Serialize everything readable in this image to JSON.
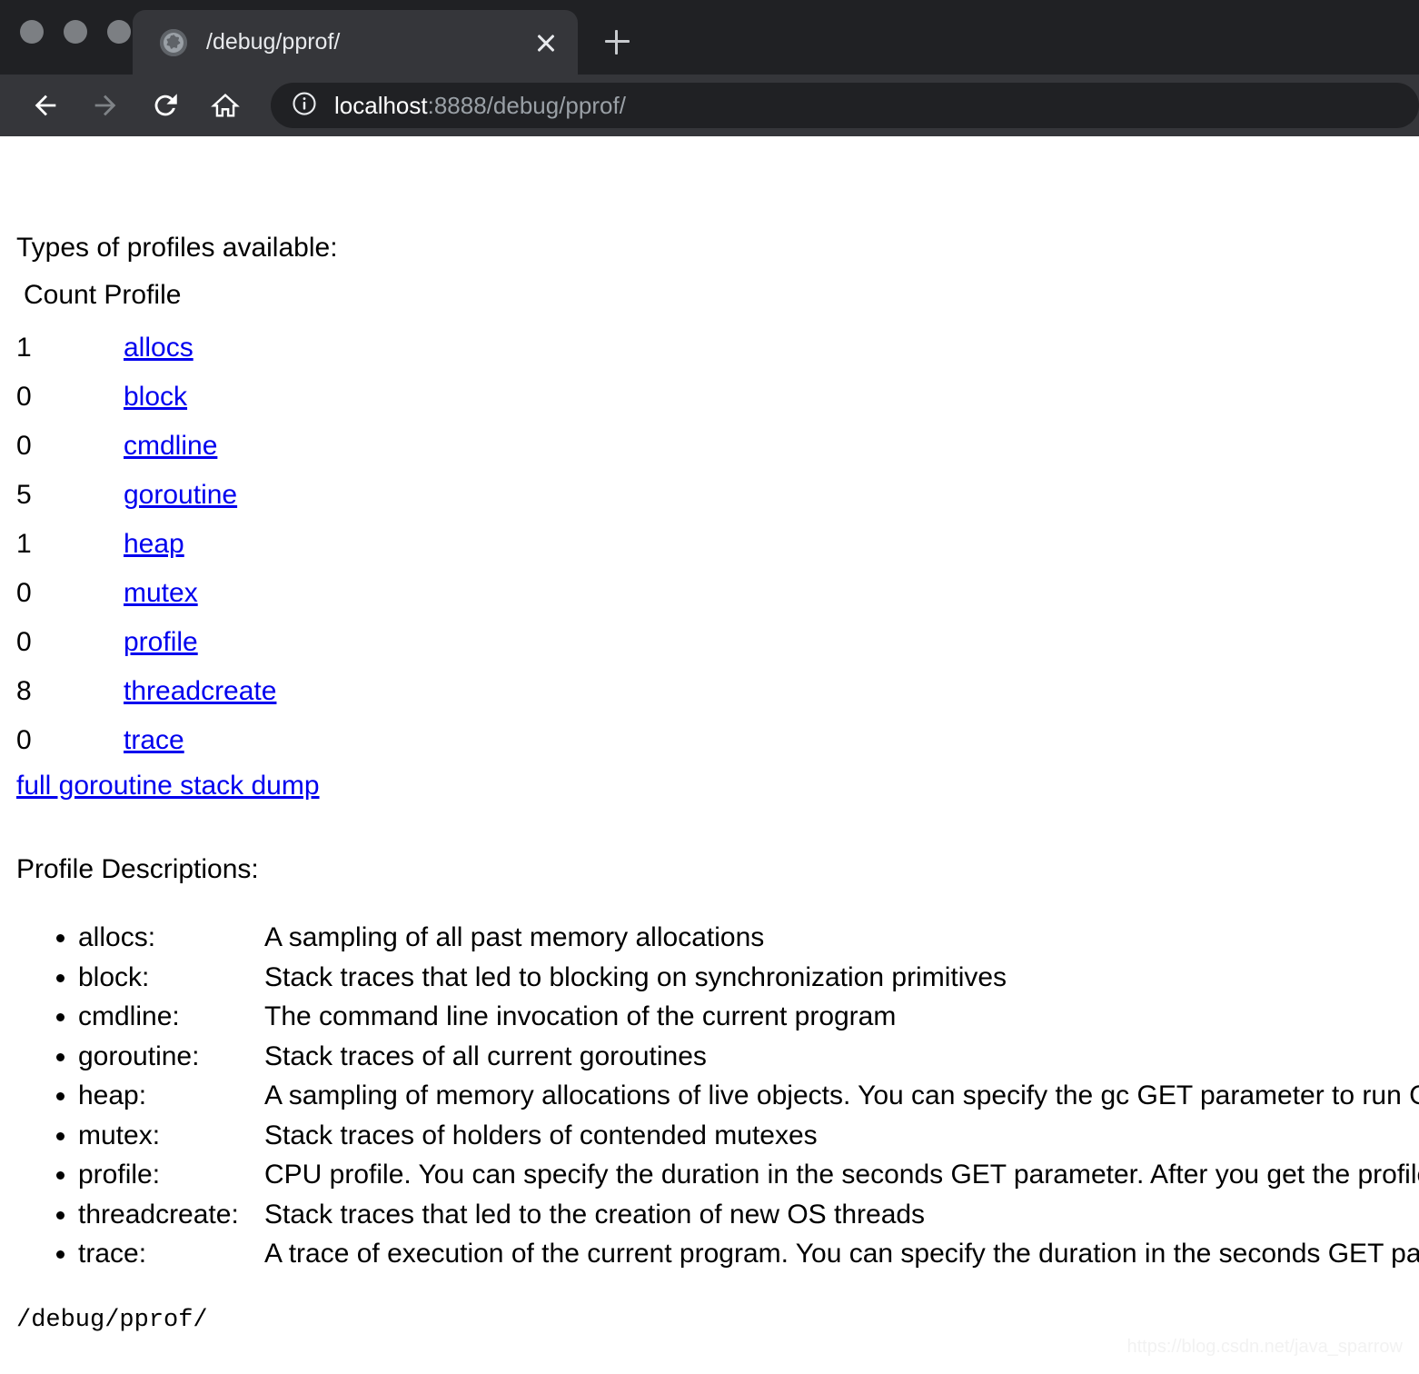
{
  "browser": {
    "window_controls": [
      "close",
      "minimize",
      "maximize"
    ],
    "tab": {
      "title": "/debug/pprof/",
      "favicon": "globe-icon",
      "close_label": "×"
    },
    "new_tab_label": "+",
    "toolbar": {
      "back_label": "←",
      "forward_label": "→",
      "reload_label": "⟳",
      "home_label": "⌂",
      "security_icon": "info-circle-icon",
      "url_host": "localhost",
      "url_rest": ":8888/debug/pprof/",
      "url_full": "localhost:8888/debug/pprof/"
    }
  },
  "page": {
    "heading": "Types of profiles available:",
    "table_header": "Count Profile",
    "profiles": [
      {
        "count": "1",
        "name": "allocs"
      },
      {
        "count": "0",
        "name": "block"
      },
      {
        "count": "0",
        "name": "cmdline"
      },
      {
        "count": "5",
        "name": "goroutine"
      },
      {
        "count": "1",
        "name": "heap"
      },
      {
        "count": "0",
        "name": "mutex"
      },
      {
        "count": "0",
        "name": "profile"
      },
      {
        "count": "8",
        "name": "threadcreate"
      },
      {
        "count": "0",
        "name": "trace"
      }
    ],
    "stack_dump_link": "full goroutine stack dump",
    "descriptions_heading": "Profile Descriptions:",
    "descriptions": [
      {
        "name": "allocs:",
        "text": "A sampling of all past memory allocations"
      },
      {
        "name": "block:",
        "text": "Stack traces that led to blocking on synchronization primitives"
      },
      {
        "name": "cmdline:",
        "text": "The command line invocation of the current program"
      },
      {
        "name": "goroutine:",
        "text": "Stack traces of all current goroutines"
      },
      {
        "name": "heap:",
        "text": "A sampling of memory allocations of live objects. You can specify the gc GET parameter to run GC before taking the heap sample."
      },
      {
        "name": "mutex:",
        "text": "Stack traces of holders of contended mutexes"
      },
      {
        "name": "profile:",
        "text": "CPU profile. You can specify the duration in the seconds GET parameter. After you get the profile file, use the go tool pprof command to investigate the profile."
      },
      {
        "name": "threadcreate:",
        "text": "Stack traces that led to the creation of new OS threads"
      },
      {
        "name": "trace:",
        "text": "A trace of execution of the current program. You can specify the duration in the seconds GET parameter. After you get the trace file, use the go tool trace command to investigate the trace."
      }
    ],
    "footer_path": "/debug/pprof/",
    "watermark": "https://blog.csdn.net/java_sparrow"
  },
  "colors": {
    "link": "#0000EE",
    "chrome_tabstrip": "#202124",
    "chrome_toolbar": "#35363A",
    "page_background": "#FFFFFF"
  }
}
